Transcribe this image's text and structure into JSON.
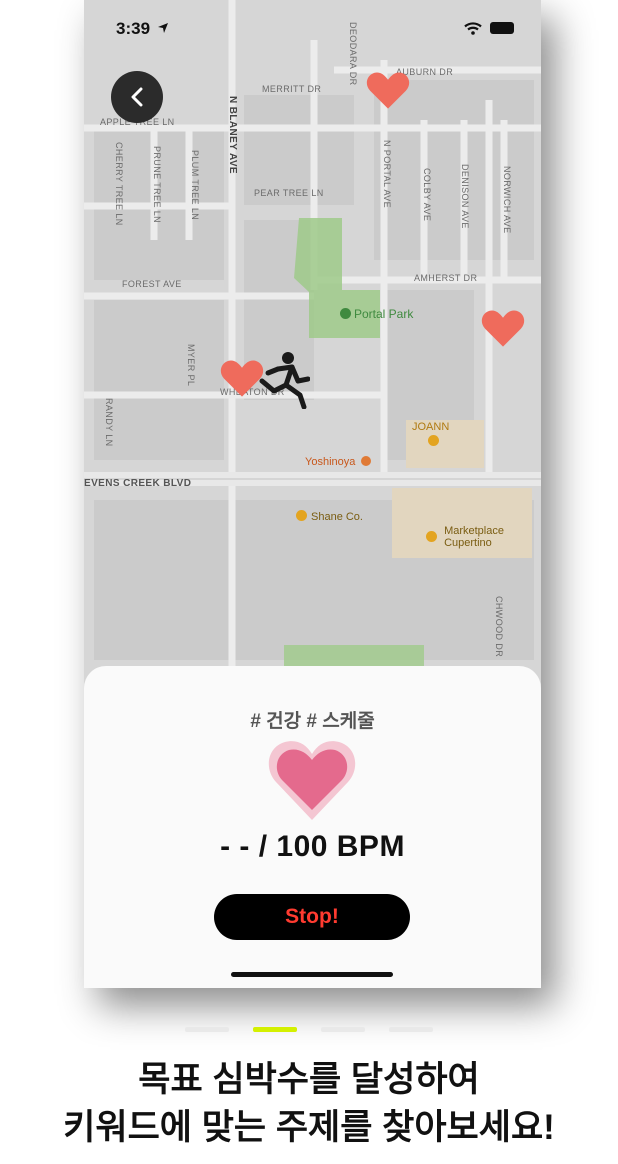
{
  "status_bar": {
    "time": "3:39"
  },
  "map": {
    "streets": {
      "merritt": "MERRITT DR",
      "auburn": "AUBURN DR",
      "apple_tree": "APPLE TREE LN",
      "deodara": "DEODARA DR",
      "n_blaney": "N BLANEY AVE",
      "cherry_tree": "CHERRY TREE LN",
      "prune_tree": "PRUNE TREE LN",
      "plum_tree": "PLUM TREE LN",
      "pear_tree": "PEAR TREE LN",
      "n_portal": "N PORTAL AVE",
      "colby": "COLBY AVE",
      "denison": "DENISON AVE",
      "norwich": "NORWICH AVE",
      "amherst": "AMHERST DR",
      "forest": "FOREST AVE",
      "myer": "MYER PL",
      "randy": "RANDY LN",
      "wheaton": "WHEATON DR",
      "stevens_creek": "EVENS CREEK BLVD",
      "chwood": "CHWOOD DR"
    },
    "pois": {
      "portal_park": "Portal Park",
      "joann": "JOANN",
      "yoshinoya": "Yoshinoya",
      "shane": "Shane Co.",
      "marketplace_1": "Marketplace",
      "marketplace_2": "Cupertino"
    }
  },
  "sheet": {
    "tags": "# 건강 # 스케줄",
    "bpm": "- - / 100 BPM",
    "stop_label": "Stop!"
  },
  "pagination": {
    "total": 4,
    "active_index": 1
  },
  "caption": {
    "line1": "목표 심박수를 달성하여",
    "line2": "키워드에 맞는 주제를 찾아보세요!"
  },
  "colors": {
    "heart_marker": "#ef6b5c",
    "active_dot": "#d4f000",
    "stop_text": "#ff3b30",
    "park": "#9fca8a"
  }
}
